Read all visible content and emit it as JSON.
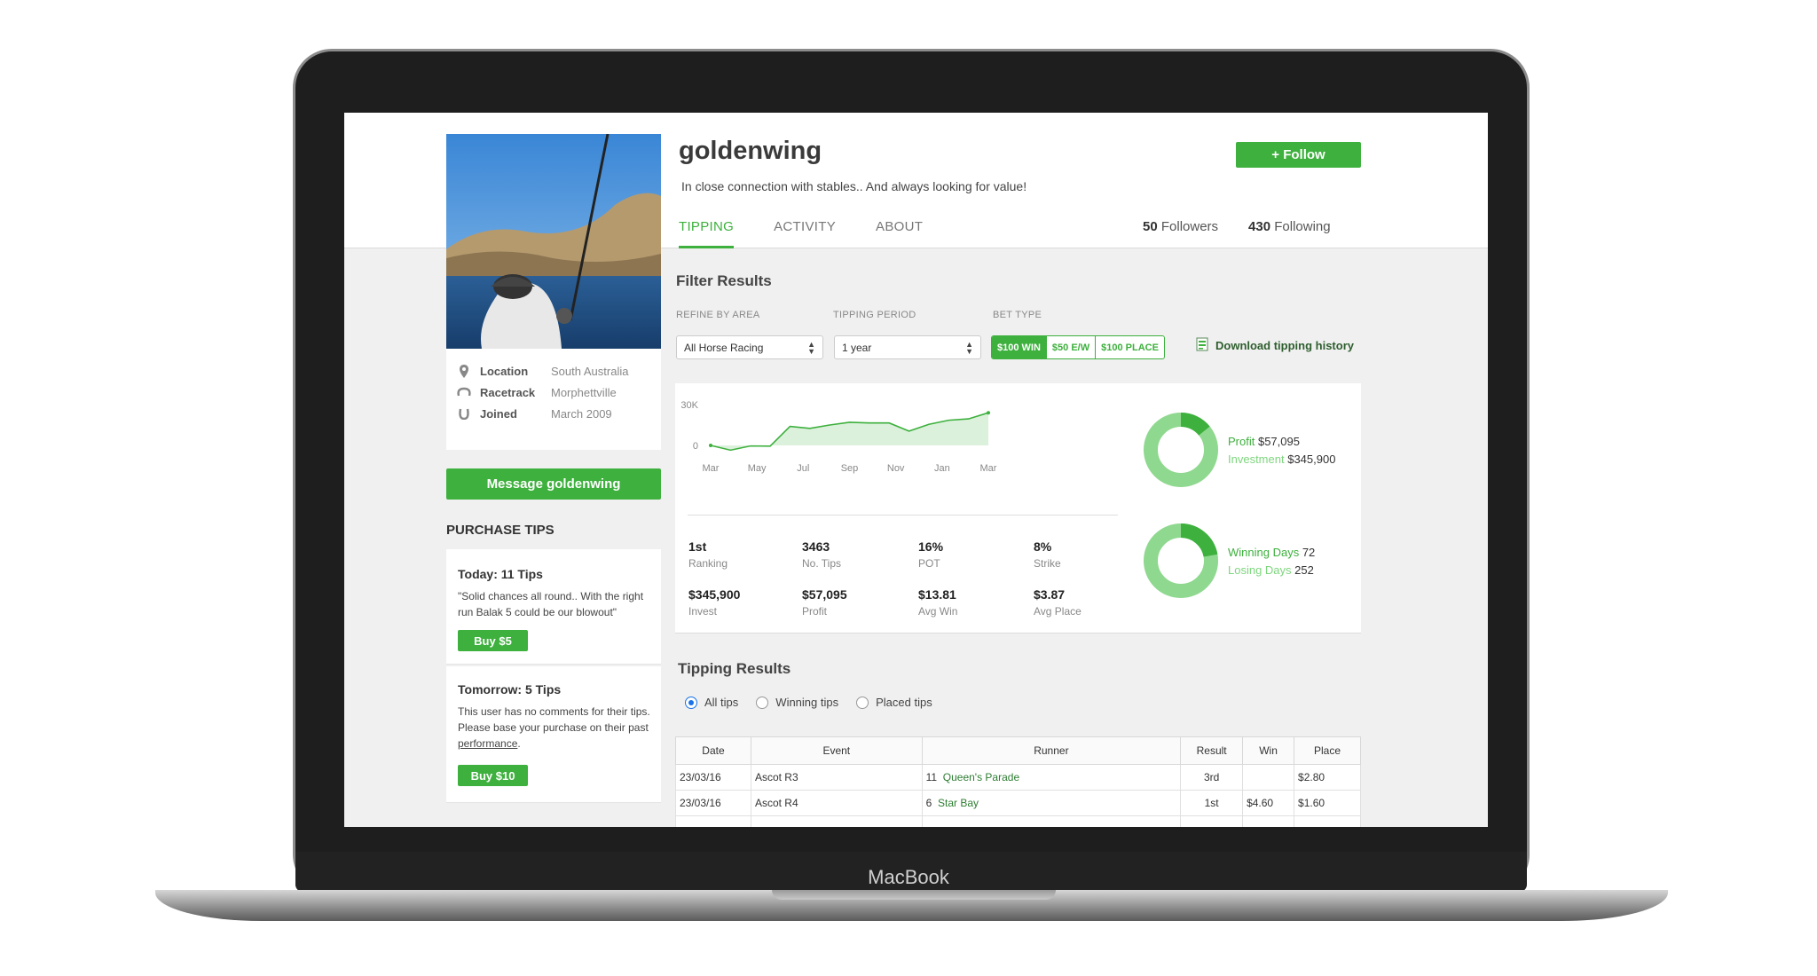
{
  "device": {
    "brand": "MacBook"
  },
  "profile": {
    "username": "goldenwing",
    "tagline": "In close connection with stables.. And always looking for value!",
    "follow_label": "+ Follow",
    "followers_count": "50",
    "followers_label": "Followers",
    "following_count": "430",
    "following_label": "Following",
    "info": [
      {
        "label": "Location",
        "value": "South Australia",
        "icon": "location-pin-icon"
      },
      {
        "label": "Racetrack",
        "value": "Morphettville",
        "icon": "horseshoe-icon"
      },
      {
        "label": "Joined",
        "value": "March 2009",
        "icon": "horseshoe-joined-icon"
      }
    ],
    "message_label": "Message goldenwing"
  },
  "tabs": [
    "TIPPING",
    "ACTIVITY",
    "ABOUT"
  ],
  "purchase": {
    "title": "PURCHASE TIPS",
    "cards": [
      {
        "title": "Today: 11 Tips",
        "text": "\"Solid chances all round.. With the right run Balak 5 could be our blowout\"",
        "button": "Buy $5"
      },
      {
        "title": "Tomorrow: 5 Tips",
        "text": "This user has no comments for their tips. Please base your purchase on their past",
        "link": "performance",
        "text_end": ".",
        "button": "Buy $10"
      }
    ]
  },
  "filter": {
    "title": "Filter Results",
    "area_label": "REFINE BY AREA",
    "area_value": "All Horse Racing",
    "period_label": "TIPPING PERIOD",
    "period_value": "1 year",
    "bet_label": "BET TYPE",
    "bets": [
      "$100 WIN",
      "$50 E/W",
      "$100 PLACE"
    ],
    "download_label": "Download tipping history"
  },
  "chart_data": {
    "type": "area",
    "x": [
      "Mar",
      "May",
      "Jul",
      "Sep",
      "Nov",
      "Jan",
      "Mar"
    ],
    "yticks": [
      "30K",
      "0"
    ],
    "ylim": [
      -2000,
      30000
    ],
    "series": [
      {
        "values": [
          0,
          -3500,
          -400,
          -500,
          14000,
          12500,
          15000,
          17000,
          16500,
          16500,
          10500,
          15500,
          18500,
          19500,
          24000
        ]
      }
    ],
    "color": "#3db03d"
  },
  "stats": [
    {
      "value": "1st",
      "label": "Ranking"
    },
    {
      "value": "3463",
      "label": "No. Tips"
    },
    {
      "value": "16%",
      "label": "POT"
    },
    {
      "value": "8%",
      "label": "Strike"
    },
    {
      "value": "$345,900",
      "label": "Invest"
    },
    {
      "value": "$57,095",
      "label": "Profit"
    },
    {
      "value": "$13.81",
      "label": "Avg Win"
    },
    {
      "value": "$3.87",
      "label": "Avg Place"
    }
  ],
  "donuts": [
    {
      "a_label": "Profit",
      "a_value": "$57,095",
      "b_label": "Investment",
      "b_value": "$345,900",
      "a_num": 57095,
      "b_num": 345900
    },
    {
      "a_label": "Winning Days",
      "a_value": "72",
      "b_label": "Losing Days",
      "b_value": "252",
      "a_num": 72,
      "b_num": 252
    }
  ],
  "colors": {
    "accent": "#3db03d",
    "accent_light": "#8fd88f"
  },
  "results": {
    "title": "Tipping Results",
    "radios": [
      "All tips",
      "Winning tips",
      "Placed tips"
    ],
    "columns": [
      "Date",
      "Event",
      "Runner",
      "Result",
      "Win",
      "Place"
    ],
    "rows": [
      {
        "date": "23/03/16",
        "event": "Ascot R3",
        "num": "11",
        "runner": "Queen's Parade",
        "result": "3rd",
        "win": "",
        "place": "$2.80"
      },
      {
        "date": "23/03/16",
        "event": "Ascot R4",
        "num": "6",
        "runner": "Star Bay",
        "result": "1st",
        "win": "$4.60",
        "place": "$1.60"
      }
    ]
  }
}
